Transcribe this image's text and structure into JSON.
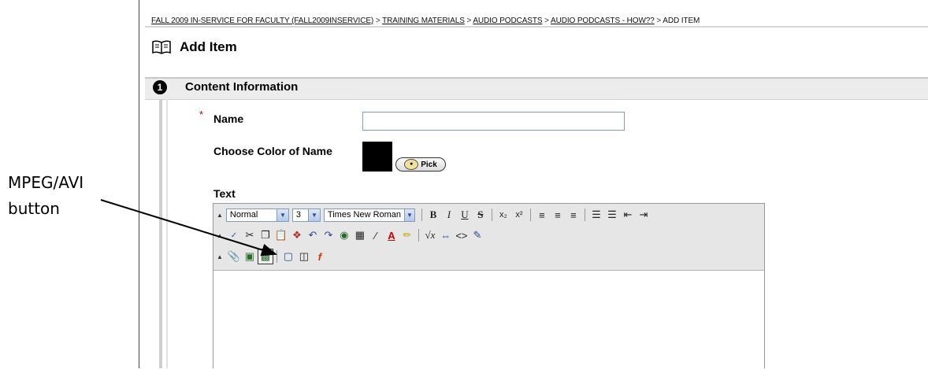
{
  "breadcrumb": {
    "items": [
      "FALL 2009 IN-SERVICE FOR FACULTY (FALL2009INSERVICE)",
      "TRAINING MATERIALS",
      "AUDIO PODCASTS",
      "AUDIO PODCASTS - HOW??"
    ],
    "separator": ">",
    "current": "ADD ITEM"
  },
  "page": {
    "title": "Add Item",
    "icon": "book-icon"
  },
  "section": {
    "number": "1",
    "title": "Content Information"
  },
  "form": {
    "required_mark": "*",
    "name_label": "Name",
    "name_value": "",
    "color_label": "Choose Color of Name",
    "color_value": "#000000",
    "pick_label": "Pick",
    "text_label": "Text"
  },
  "editor": {
    "style_value": "Normal",
    "size_value": "3",
    "font_value": "Times New Roman",
    "row1_icons": [
      "bold-icon",
      "italic-icon",
      "underline-icon",
      "strikethrough-icon",
      "subscript-icon",
      "superscript-icon",
      "align-left-icon",
      "align-center-icon",
      "align-right-icon",
      "ordered-list-icon",
      "unordered-list-icon",
      "outdent-icon",
      "indent-icon"
    ],
    "row2_icons": [
      "spellcheck-icon",
      "cut-icon",
      "copy-icon",
      "paste-icon",
      "paste-special-icon",
      "undo-icon",
      "redo-icon",
      "link-icon",
      "table-icon",
      "line-icon",
      "font-color-icon",
      "highlight-icon",
      "equation-icon",
      "toggle-view-icon",
      "html-icon",
      "preview-icon"
    ],
    "row3_icons": [
      "attach-file-icon",
      "insert-image-icon",
      "mpeg-avi-icon",
      "audio-icon",
      "multimedia-icon",
      "flash-icon"
    ]
  },
  "annotation": {
    "line1": "MPEG/AVI",
    "line2": "button"
  }
}
